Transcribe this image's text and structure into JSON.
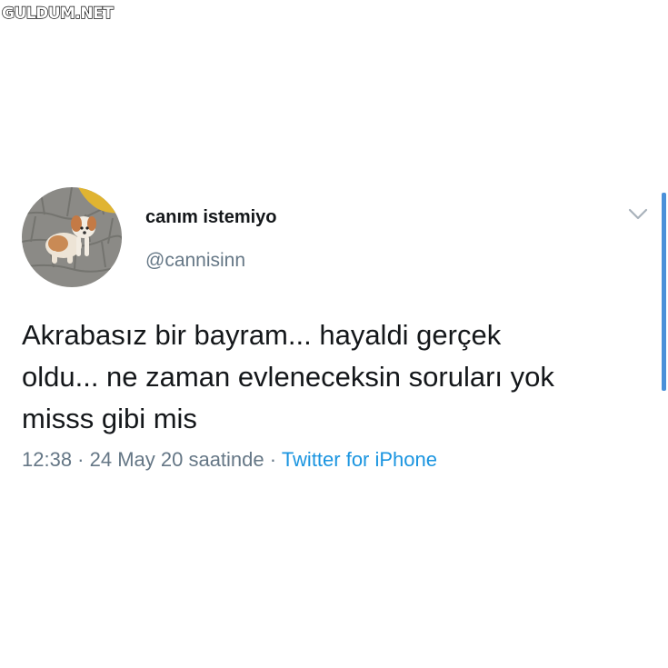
{
  "watermark": "GULDUM.NET",
  "tweet": {
    "display_name": "canım istemiyo",
    "handle": "@cannisinn",
    "text": "Akrabasız bir bayram... hayaldi gerçek\noldu... ne zaman evleneceksin soruları yok\nmisss gibi mis",
    "time": "12:38",
    "separator": " · ",
    "date": "24 May 20 saatinde",
    "source": "Twitter for iPhone"
  },
  "icons": {
    "avatar": "puppy-avatar",
    "menu": "chevron-down-icon"
  },
  "colors": {
    "text": "#14171a",
    "secondary": "#657786",
    "link": "#1b95e0",
    "scrollbar": "#4a90d9"
  }
}
